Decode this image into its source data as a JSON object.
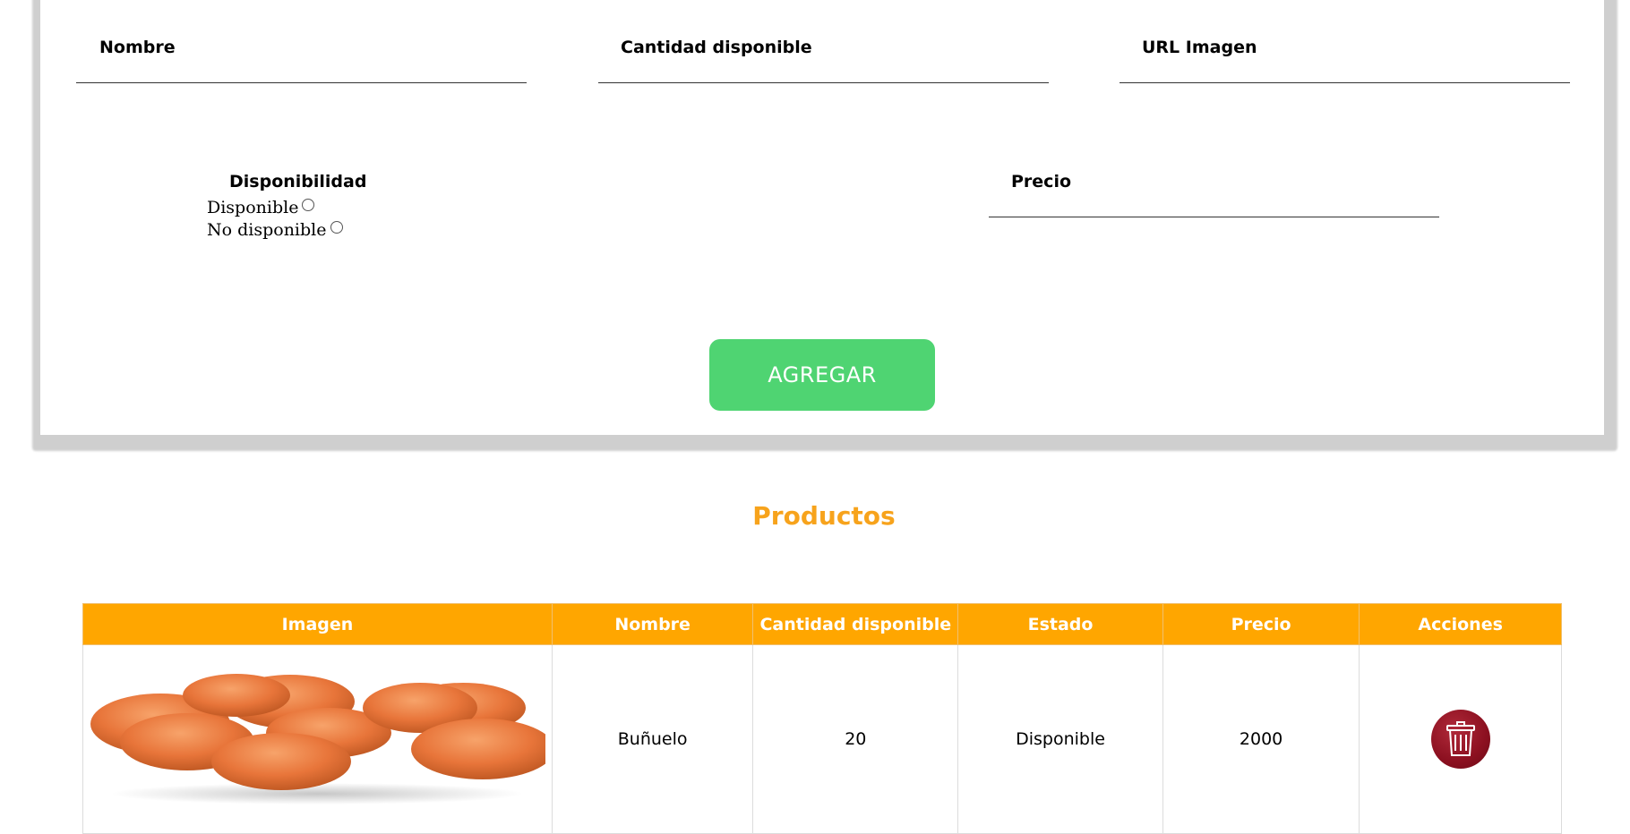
{
  "form": {
    "fields": {
      "nombre": {
        "label": "Nombre",
        "value": ""
      },
      "cantidad": {
        "label": "Cantidad disponible",
        "value": ""
      },
      "url": {
        "label": "URL Imagen",
        "value": ""
      },
      "precio": {
        "label": "Precio",
        "value": ""
      }
    },
    "disponibilidad": {
      "label": "Disponibilidad",
      "options": [
        "Disponible",
        "No disponible"
      ],
      "selected": null
    },
    "submit_label": "AGREGAR",
    "submit_color": "#4fd472"
  },
  "products": {
    "title": "Productos",
    "title_color": "#f7a31c",
    "header_color": "#ffa600",
    "columns": [
      "Imagen",
      "Nombre",
      "Cantidad disponible",
      "Estado",
      "Precio",
      "Acciones"
    ],
    "rows": [
      {
        "image_icon": "bunuelo-image",
        "nombre": "Buñuelo",
        "cantidad": "20",
        "estado": "Disponible",
        "precio": "2000",
        "action_icon": "trash-icon"
      }
    ]
  }
}
